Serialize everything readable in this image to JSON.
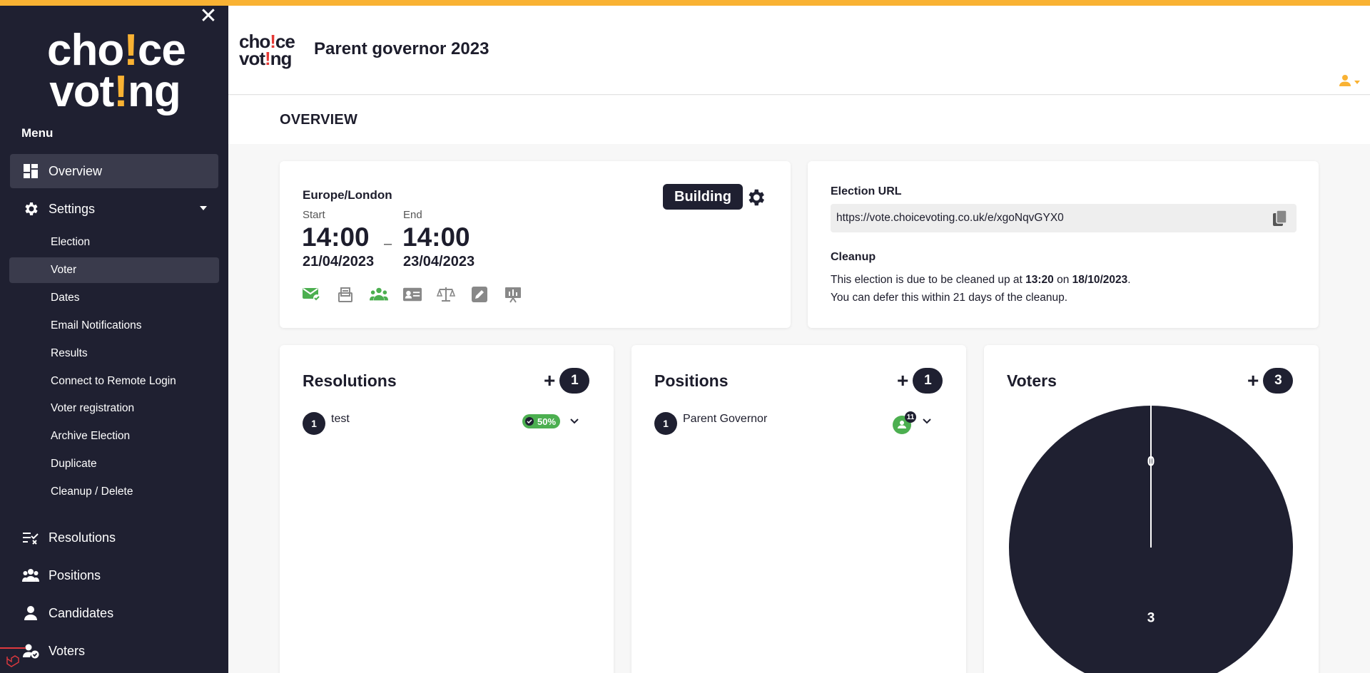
{
  "sidebar": {
    "menu_label": "Menu",
    "main_items": [
      {
        "label": "Overview",
        "icon": "dashboard-icon"
      },
      {
        "label": "Settings",
        "icon": "gear-icon"
      }
    ],
    "sub_items": [
      "Election",
      "Voter",
      "Dates",
      "Email Notifications",
      "Results",
      "Connect to Remote Login",
      "Voter registration",
      "Archive Election",
      "Duplicate",
      "Cleanup / Delete"
    ],
    "bottom_items": [
      {
        "label": "Resolutions",
        "icon": "resolutions-icon"
      },
      {
        "label": "Positions",
        "icon": "positions-icon"
      },
      {
        "label": "Candidates",
        "icon": "candidate-icon"
      },
      {
        "label": "Voters",
        "icon": "voters-icon"
      }
    ]
  },
  "header": {
    "title": "Parent governor 2023"
  },
  "page": {
    "heading": "OVERVIEW"
  },
  "dates_card": {
    "timezone": "Europe/London",
    "start_label": "Start",
    "start_time": "14:00",
    "start_date": "21/04/2023",
    "separator": "–",
    "end_label": "End",
    "end_time": "14:00",
    "end_date": "23/04/2023",
    "status": "Building"
  },
  "url_card": {
    "title": "Election URL",
    "url": "https://vote.choicevoting.co.uk/e/xgoNqvGYX0",
    "cleanup_title": "Cleanup",
    "cleanup_prefix": "This election is due to be cleaned up at ",
    "cleanup_time": "13:20",
    "cleanup_mid": " on ",
    "cleanup_date": "18/10/2023",
    "cleanup_suffix": ".",
    "cleanup_note": "You can defer this within 21 days of the cleanup."
  },
  "resolutions": {
    "title": "Resolutions",
    "count": "1",
    "items": [
      {
        "number": "1",
        "label": "test",
        "badge": "50%"
      }
    ]
  },
  "positions": {
    "title": "Positions",
    "count": "1",
    "items": [
      {
        "number": "1",
        "label": "Parent Governor",
        "badge_count": "11"
      }
    ]
  },
  "voters": {
    "title": "Voters",
    "count": "3",
    "chart_data": {
      "type": "pie",
      "values": [
        0,
        3
      ],
      "labels": [
        "0",
        "3"
      ],
      "colors": [
        "#1f2031",
        "#1f2031"
      ]
    }
  },
  "colors": {
    "brand_yellow": "#f9b233",
    "sidebar_bg": "#1f2031",
    "active_item": "#3a3b4c",
    "success_green": "#4caf50"
  }
}
